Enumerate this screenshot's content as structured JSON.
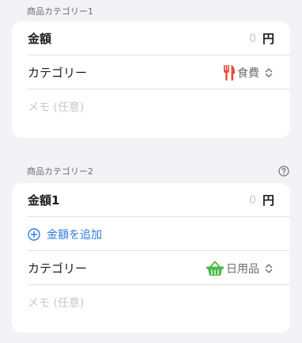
{
  "section1": {
    "header": "商品カテゴリー1",
    "amount_label": "金額",
    "amount_value": "0",
    "amount_unit": "円",
    "category_label": "カテゴリー",
    "category_value": "食費",
    "category_icon": "fork-knife-icon",
    "memo_placeholder": "メモ (任意)"
  },
  "section2": {
    "header": "商品カテゴリー2",
    "help_icon": "question-circle-icon",
    "amount_label": "金額1",
    "amount_value": "0",
    "amount_unit": "円",
    "add_amount_label": "金額を追加",
    "category_label": "カテゴリー",
    "category_value": "日用品",
    "category_icon": "basket-icon",
    "memo_placeholder": "メモ (任意)"
  },
  "colors": {
    "accent_blue": "#2f7ae5",
    "food_red": "#e94b3c",
    "basket_green": "#4cb94a"
  }
}
